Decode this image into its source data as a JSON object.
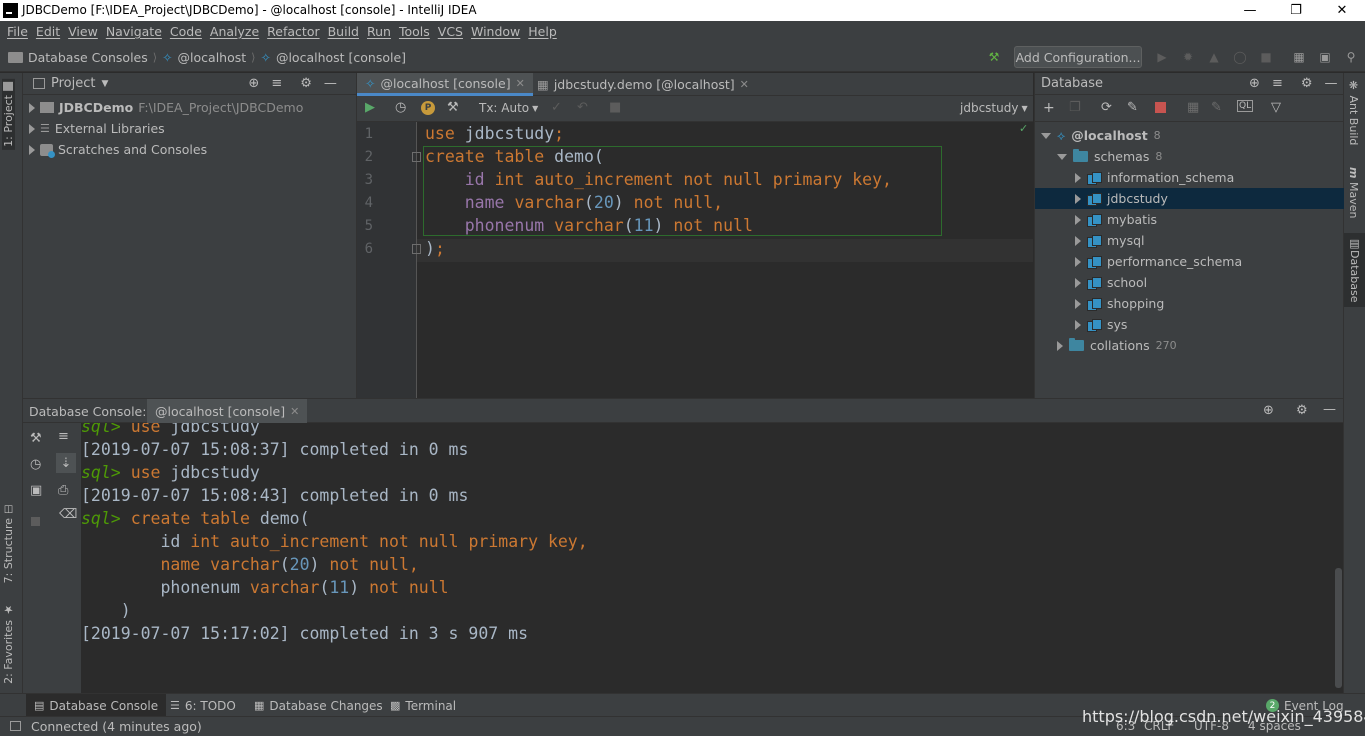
{
  "window": {
    "title": "JDBCDemo [F:\\IDEA_Project\\JDBCDemo] - @localhost [console] - IntelliJ IDEA",
    "app_icon": "intellij-icon",
    "controls": [
      "minimize",
      "maximize",
      "close"
    ]
  },
  "menu": [
    "File",
    "Edit",
    "View",
    "Navigate",
    "Code",
    "Analyze",
    "Refactor",
    "Build",
    "Run",
    "Tools",
    "VCS",
    "Window",
    "Help"
  ],
  "breadcrumb": {
    "items": [
      "Database Consoles",
      "@localhost",
      "@localhost [console]"
    ]
  },
  "toolbar": {
    "add_configuration": "Add Configuration..."
  },
  "left_strip": {
    "project": "1: Project",
    "structure": "7: Structure",
    "favorites": "2: Favorites"
  },
  "right_strip": {
    "ant": "Ant Build",
    "maven": "Maven",
    "database": "Database"
  },
  "project_panel": {
    "title": "Project",
    "rows": [
      {
        "label": "JDBCDemo",
        "path": "F:\\IDEA_Project\\JDBCDemo"
      },
      {
        "label": "External Libraries"
      },
      {
        "label": "Scratches and Consoles"
      }
    ]
  },
  "editor": {
    "tabs": [
      {
        "label": "@localhost [console]",
        "active": true
      },
      {
        "label": "jdbcstudy.demo [@localhost]",
        "active": false
      }
    ],
    "tx_mode": "Tx: Auto",
    "schema_selector": "jdbcstudy",
    "line_numbers": [
      "1",
      "2",
      "3",
      "4",
      "5",
      "6"
    ],
    "lines": [
      [
        {
          "t": "use",
          "c": "kw"
        },
        {
          "t": " jdbcstudy",
          "c": "pl"
        },
        {
          "t": ";",
          "c": "kw"
        }
      ],
      [
        {
          "t": "create",
          "c": "kw"
        },
        {
          "t": " ",
          "c": "pl"
        },
        {
          "t": "table",
          "c": "kw"
        },
        {
          "t": " demo(",
          "c": "pl"
        }
      ],
      [
        {
          "t": "    ",
          "c": "pl"
        },
        {
          "t": "id",
          "c": "fld"
        },
        {
          "t": " ",
          "c": "pl"
        },
        {
          "t": "int",
          "c": "kw"
        },
        {
          "t": " ",
          "c": "pl"
        },
        {
          "t": "auto_increment",
          "c": "kw"
        },
        {
          "t": " ",
          "c": "pl"
        },
        {
          "t": "not null",
          "c": "kw"
        },
        {
          "t": " ",
          "c": "pl"
        },
        {
          "t": "primary key",
          "c": "kw"
        },
        {
          "t": ",",
          "c": "kw"
        }
      ],
      [
        {
          "t": "    ",
          "c": "pl"
        },
        {
          "t": "name",
          "c": "fld"
        },
        {
          "t": " ",
          "c": "pl"
        },
        {
          "t": "varchar",
          "c": "kw"
        },
        {
          "t": "(",
          "c": "pl"
        },
        {
          "t": "20",
          "c": "num"
        },
        {
          "t": ") ",
          "c": "pl"
        },
        {
          "t": "not null",
          "c": "kw"
        },
        {
          "t": ",",
          "c": "kw"
        }
      ],
      [
        {
          "t": "    ",
          "c": "pl"
        },
        {
          "t": "phonenum",
          "c": "fld"
        },
        {
          "t": " ",
          "c": "pl"
        },
        {
          "t": "varchar",
          "c": "kw"
        },
        {
          "t": "(",
          "c": "pl"
        },
        {
          "t": "11",
          "c": "num"
        },
        {
          "t": ") ",
          "c": "pl"
        },
        {
          "t": "not null",
          "c": "kw"
        }
      ],
      [
        {
          "t": ")",
          "c": "pl"
        },
        {
          "t": ";",
          "c": "kw"
        }
      ]
    ]
  },
  "database_panel": {
    "title": "Database",
    "rows": [
      {
        "label": "@localhost",
        "count": "8",
        "kind": "host"
      },
      {
        "label": "schemas",
        "count": "8",
        "kind": "folder"
      },
      {
        "label": "information_schema",
        "kind": "schema"
      },
      {
        "label": "jdbcstudy",
        "kind": "schema",
        "selected": true
      },
      {
        "label": "mybatis",
        "kind": "schema"
      },
      {
        "label": "mysql",
        "kind": "schema"
      },
      {
        "label": "performance_schema",
        "kind": "schema"
      },
      {
        "label": "school",
        "kind": "schema"
      },
      {
        "label": "shopping",
        "kind": "schema"
      },
      {
        "label": "sys",
        "kind": "schema"
      },
      {
        "label": "collations",
        "count": "270",
        "kind": "folder"
      }
    ]
  },
  "console": {
    "title": "Database Console:",
    "tab": "@localhost [console]",
    "lines": [
      [
        {
          "t": "sql>",
          "c": "prompt"
        },
        {
          "t": " ",
          "c": "pl"
        },
        {
          "t": "use",
          "c": "kw"
        },
        {
          "t": " jdbcstudy",
          "c": "pl"
        }
      ],
      [
        {
          "t": "[2019-07-07 15:08:37] completed in 0 ms",
          "c": "pl"
        }
      ],
      [
        {
          "t": "sql>",
          "c": "prompt"
        },
        {
          "t": " ",
          "c": "pl"
        },
        {
          "t": "use",
          "c": "kw"
        },
        {
          "t": " jdbcstudy",
          "c": "pl"
        }
      ],
      [
        {
          "t": "[2019-07-07 15:08:43] completed in 0 ms",
          "c": "pl"
        }
      ],
      [
        {
          "t": "sql>",
          "c": "prompt"
        },
        {
          "t": " ",
          "c": "pl"
        },
        {
          "t": "create",
          "c": "kw"
        },
        {
          "t": " ",
          "c": "pl"
        },
        {
          "t": "table",
          "c": "kw"
        },
        {
          "t": " demo(",
          "c": "pl"
        }
      ],
      [
        {
          "t": "        id ",
          "c": "pl"
        },
        {
          "t": "int",
          "c": "kw"
        },
        {
          "t": " ",
          "c": "pl"
        },
        {
          "t": "auto_increment",
          "c": "kw"
        },
        {
          "t": " ",
          "c": "pl"
        },
        {
          "t": "not null",
          "c": "kw"
        },
        {
          "t": " ",
          "c": "pl"
        },
        {
          "t": "primary key",
          "c": "kw"
        },
        {
          "t": ",",
          "c": "kw"
        }
      ],
      [
        {
          "t": "        ",
          "c": "pl"
        },
        {
          "t": "name",
          "c": "kw"
        },
        {
          "t": " ",
          "c": "pl"
        },
        {
          "t": "varchar",
          "c": "kw"
        },
        {
          "t": "(",
          "c": "pl"
        },
        {
          "t": "20",
          "c": "num"
        },
        {
          "t": ") ",
          "c": "pl"
        },
        {
          "t": "not null",
          "c": "kw"
        },
        {
          "t": ",",
          "c": "kw"
        }
      ],
      [
        {
          "t": "        phonenum ",
          "c": "pl"
        },
        {
          "t": "varchar",
          "c": "kw"
        },
        {
          "t": "(",
          "c": "pl"
        },
        {
          "t": "11",
          "c": "num"
        },
        {
          "t": ") ",
          "c": "pl"
        },
        {
          "t": "not null",
          "c": "kw"
        }
      ],
      [
        {
          "t": "    )",
          "c": "pl"
        }
      ],
      [
        {
          "t": "[2019-07-07 15:17:02] completed in 3 s 907 ms",
          "c": "pl"
        }
      ]
    ]
  },
  "bottom_tabs": [
    {
      "label": "Database Console",
      "active": true
    },
    {
      "label": "6: TODO"
    },
    {
      "label": "Database Changes"
    },
    {
      "label": "Terminal"
    }
  ],
  "event_log": {
    "badge": "2",
    "label": "Event Log"
  },
  "status": {
    "message": "Connected (4 minutes ago)",
    "position": "6:3",
    "line_sep": "CRLF",
    "encoding": "UTF-8",
    "indent": "4 spaces",
    "watermark": "https://blog.csdn.net/weixin_43958460"
  },
  "colors": {
    "keyword": "#cc7832",
    "number": "#6897bb",
    "field": "#9876aa",
    "plain": "#a9b7c6",
    "prompt": "#4e9a06",
    "selection": "#0d293e",
    "accent": "#4a88c7"
  }
}
